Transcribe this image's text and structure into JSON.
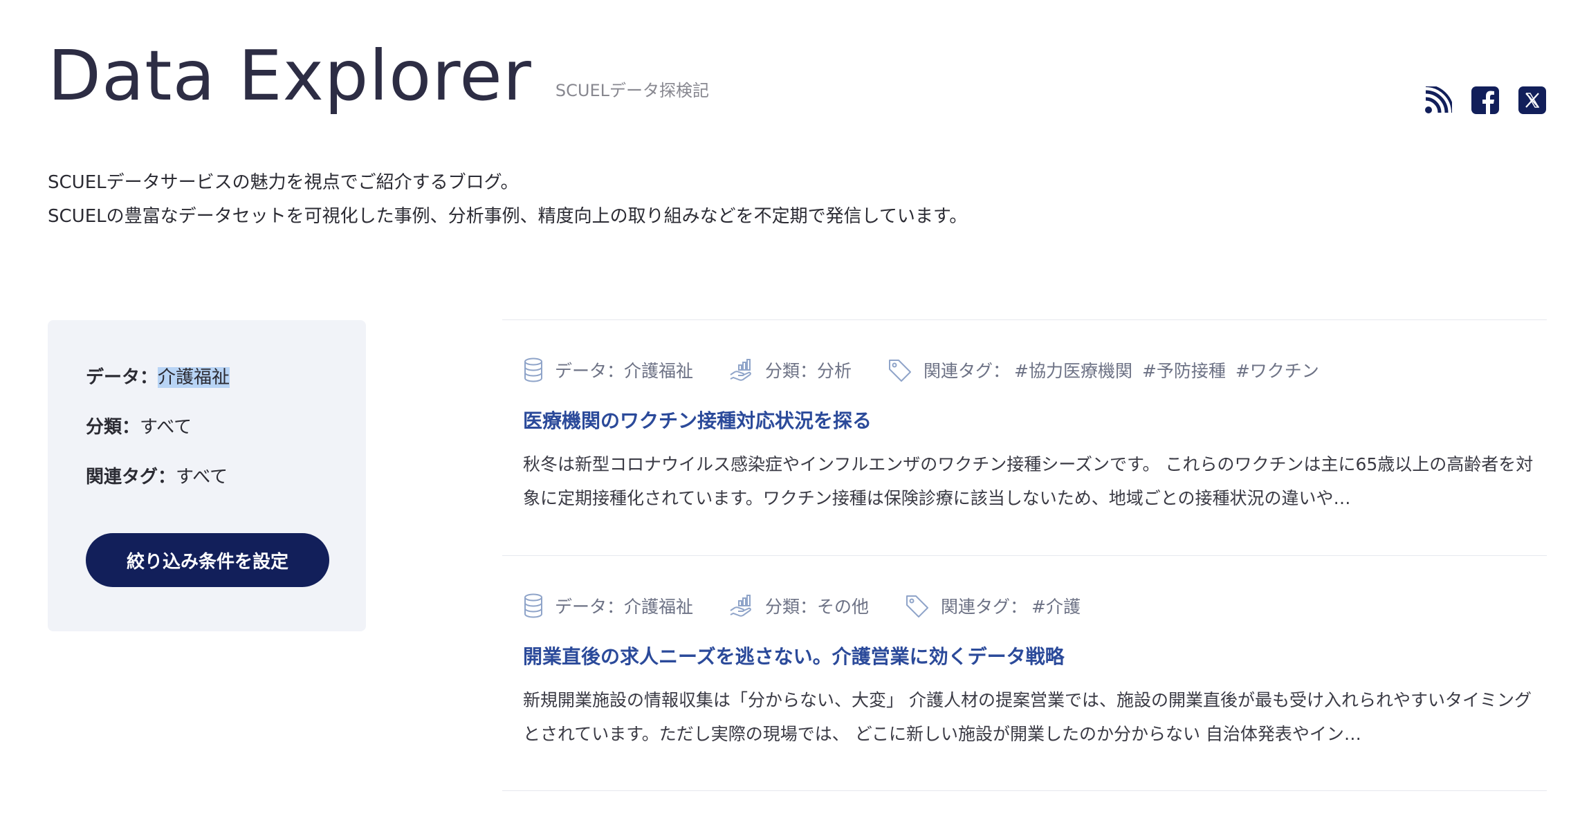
{
  "header": {
    "title": "Data Explorer",
    "subtitle": "SCUELデータ探検記"
  },
  "social": {
    "icons": [
      "rss-icon",
      "facebook-icon",
      "x-icon"
    ],
    "color": "#121f5a"
  },
  "intro": {
    "line1": "SCUELデータサービスの魅力を視点でご紹介するブログ。",
    "line2": "SCUELの豊富なデータセットを可視化した事例、分析事例、精度向上の取り組みなどを不定期で発信しています。"
  },
  "filter": {
    "data_label": "データ：",
    "data_value": "介護福祉",
    "category_label": "分類：",
    "category_value": "すべて",
    "tags_label": "関連タグ：",
    "tags_value": "すべて",
    "button_label": "絞り込み条件を設定"
  },
  "articles": [
    {
      "data": "データ：介護福祉",
      "category": "分類：分析",
      "tags_label": "関連タグ：",
      "tags": [
        "#協力医療機関",
        "#予防接種",
        "#ワクチン"
      ],
      "title": "医療機関のワクチン接種対応状況を探る",
      "excerpt": "秋冬は新型コロナウイルス感染症やインフルエンザのワクチン接種シーズンです。 これらのワクチンは主に65歳以上の高齢者を対象に定期接種化されています。ワクチン接種は保険診療に該当しないため、地域ごとの接種状況の違いや…"
    },
    {
      "data": "データ：介護福祉",
      "category": "分類：その他",
      "tags_label": "関連タグ：",
      "tags": [
        "#介護"
      ],
      "title": "開業直後の求人ニーズを逃さない。介護営業に効くデータ戦略",
      "excerpt": "新規開業施設の情報収集は「分からない、大変」 介護人材の提案営業では、施設の開業直後が最も受け入れられやすいタイミングとされています。ただし実際の現場では、 どこに新しい施設が開業したのか分からない 自治体発表やイン…"
    }
  ],
  "colors": {
    "accent": "#121f5a",
    "link": "#2b4a9a",
    "filter_bg": "#f1f3f8",
    "highlight": "#b8d4f5"
  }
}
